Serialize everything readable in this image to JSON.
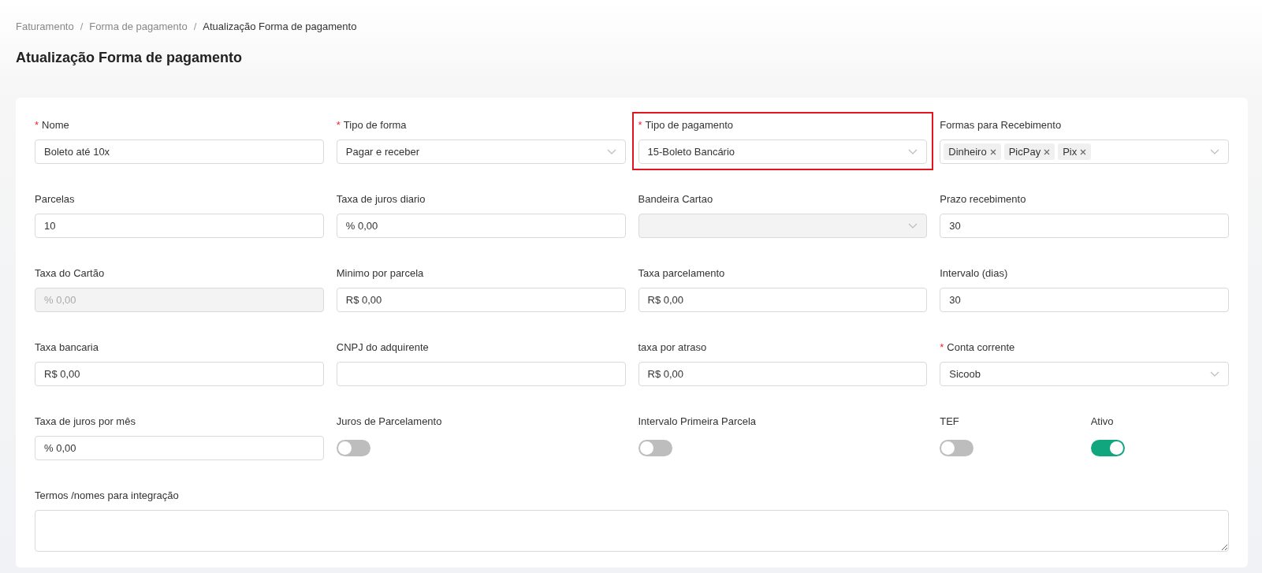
{
  "breadcrumb": [
    {
      "label": "Faturamento",
      "current": false
    },
    {
      "label": "Forma de pagamento",
      "current": false
    },
    {
      "label": "Atualização Forma de pagamento",
      "current": true
    }
  ],
  "breadcrumb_separator": "/",
  "required_mark": "*",
  "title": "Atualização Forma de pagamento",
  "form_rows": [
    [
      {
        "kind": "input",
        "label": "Nome",
        "required": true,
        "value": "Boleto até 10x"
      },
      {
        "kind": "select",
        "label": "Tipo de forma",
        "required": true,
        "value": "Pagar e receber"
      },
      {
        "kind": "select",
        "label": "Tipo de pagamento",
        "required": true,
        "value": "15-Boleto Bancário",
        "highlighted": true
      },
      {
        "kind": "tags",
        "label": "Formas para Recebimento",
        "required": false,
        "tags": [
          "Dinheiro",
          "PicPay",
          "Pix"
        ]
      }
    ],
    [
      {
        "kind": "input",
        "label": "Parcelas",
        "required": false,
        "value": "10"
      },
      {
        "kind": "input",
        "label": "Taxa de juros diario",
        "required": false,
        "value": "% 0,00"
      },
      {
        "kind": "select",
        "label": "Bandeira Cartao",
        "required": false,
        "disabled": true
      },
      {
        "kind": "input",
        "label": "Prazo recebimento",
        "required": false,
        "value": "30"
      }
    ],
    [
      {
        "kind": "input",
        "label": "Taxa do Cartão",
        "required": false,
        "value": "% 0,00",
        "disabled": true
      },
      {
        "kind": "input",
        "label": "Minimo por parcela",
        "required": false,
        "value": "R$ 0,00"
      },
      {
        "kind": "input",
        "label": "Taxa parcelamento",
        "required": false,
        "value": "R$ 0,00"
      },
      {
        "kind": "input",
        "label": "Intervalo (dias)",
        "required": false,
        "value": "30"
      }
    ],
    [
      {
        "kind": "input",
        "label": "Taxa bancaria",
        "required": false,
        "value": "R$ 0,00"
      },
      {
        "kind": "input",
        "label": "CNPJ do adquirente",
        "required": false
      },
      {
        "kind": "input",
        "label": "taxa por atraso",
        "required": false,
        "value": "R$ 0,00"
      },
      {
        "kind": "select",
        "label": "Conta corrente",
        "required": true,
        "value": "Sicoob"
      }
    ],
    [
      {
        "kind": "input",
        "label": "Taxa de juros por mês",
        "required": false,
        "value": "% 0,00"
      },
      {
        "kind": "switch",
        "label": "Juros de Parcelamento",
        "on": false
      },
      {
        "kind": "switch",
        "label": "Intervalo Primeira Parcela",
        "on": false
      },
      {
        "kind": "switch",
        "label": "TEF",
        "on": false
      },
      {
        "kind": "switch",
        "label": "Ativo",
        "on": true
      }
    ],
    [
      {
        "kind": "textarea",
        "label": "Termos /nomes para integração",
        "required": false
      }
    ]
  ]
}
